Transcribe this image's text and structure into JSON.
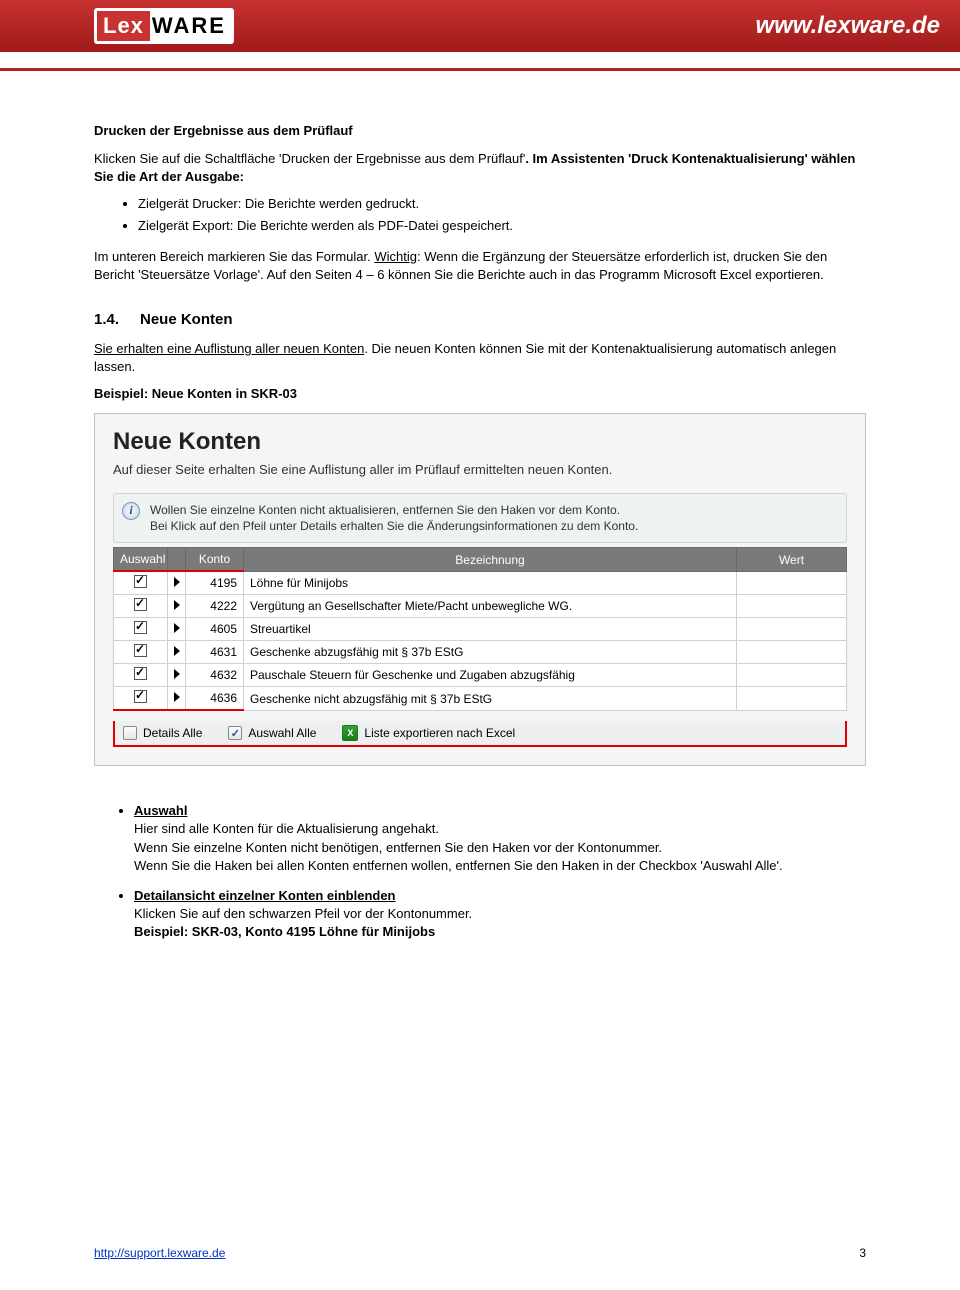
{
  "header": {
    "logo_left": "Lex",
    "logo_right": "WARE",
    "url": "www.lexware.de"
  },
  "doc": {
    "h1": "Drucken der Ergebnisse aus dem Prüflauf",
    "p1a": "Klicken Sie auf die Schaltfläche 'Drucken der Ergebnisse aus dem Prüflauf'",
    "p1b": ". Im Assistenten 'Druck Kontenaktualisierung' wählen Sie die Art der Ausgabe:",
    "list1": [
      "Zielgerät Drucker: Die Berichte werden gedruckt.",
      "Zielgerät Export: Die Berichte werden als PDF-Datei gespeichert."
    ],
    "p2a": "Im unteren Bereich markieren Sie das Formular. ",
    "p2b_under": "Wichtig",
    "p2c": ": Wenn die Ergänzung der Steuersätze erforderlich ist, drucken Sie den Bericht 'Steuersätze Vorlage'. Auf den Seiten 4 – 6 können Sie die Berichte auch in das Programm Microsoft Excel exportieren.",
    "h2_num": "1.4.",
    "h2_text": "Neue Konten",
    "p3a": "Sie erhalten eine Auflistung aller neuen Konten",
    "p3b": ". Die neuen Konten können Sie mit der Kontenaktualisierung automatisch anlegen lassen.",
    "p4": "Beispiel: Neue Konten in SKR-03",
    "list2a_title": "Auswahl",
    "list2a_l1": "Hier sind alle Konten für die Aktualisierung angehakt.",
    "list2a_l2": "Wenn Sie einzelne Konten nicht benötigen, entfernen Sie den Haken vor der Kontonummer.",
    "list2a_l3": "Wenn Sie die Haken bei allen Konten entfernen wollen, entfernen Sie den Haken in der Checkbox 'Auswahl Alle'.",
    "list2b_title": "Detailansicht einzelner Konten einblenden",
    "list2b_l1": "Klicken Sie auf den schwarzen Pfeil vor der Kontonummer.",
    "list2b_l2": "Beispiel: SKR-03, Konto 4195 Löhne für Minijobs"
  },
  "shot": {
    "title": "Neue Konten",
    "sub": "Auf dieser Seite erhalten Sie eine Auflistung aller im Prüflauf ermittelten neuen Konten.",
    "info_l1": "Wollen Sie einzelne Konten nicht aktualisieren, entfernen Sie den Haken vor dem Konto.",
    "info_l2": "Bei Klick auf den Pfeil unter Details erhalten Sie die Änderungsinformationen zu dem Konto.",
    "th_auswahl": "Auswahl",
    "th_konto": "Konto",
    "th_bez": "Bezeichnung",
    "th_wert": "Wert",
    "rows": [
      {
        "konto": "4195",
        "bez": "Löhne für Minijobs"
      },
      {
        "konto": "4222",
        "bez": "Vergütung an Gesellschafter Miete/Pacht unbewegliche WG."
      },
      {
        "konto": "4605",
        "bez": "Streuartikel"
      },
      {
        "konto": "4631",
        "bez": "Geschenke abzugsfähig mit § 37b EStG"
      },
      {
        "konto": "4632",
        "bez": "Pauschale Steuern für Geschenke und Zugaben abzugsfähig"
      },
      {
        "konto": "4636",
        "bez": "Geschenke nicht abzugsfähig mit § 37b EStG"
      }
    ],
    "tool_details": "Details Alle",
    "tool_auswahl": "Auswahl Alle",
    "tool_export": "Liste exportieren nach Excel"
  },
  "footer": {
    "link": "http://support.lexware.de",
    "page": "3"
  }
}
